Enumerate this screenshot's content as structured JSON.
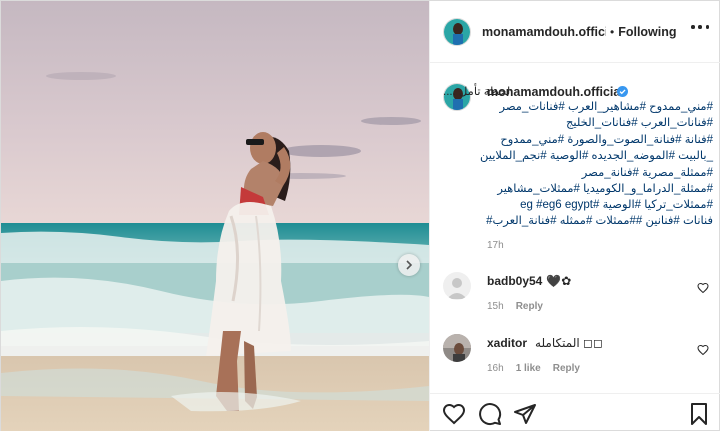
{
  "post": {
    "username": "monamamdouh.official",
    "header_username": "monamamdouh.officia",
    "dot": "•",
    "follow_label": "Following",
    "caption": {
      "lines": [
        "لحظة تأمل ....",
        "#مني_ممدوح #مشاهير_العرب #فنانات_مصر",
        "#فنانات_العرب #فنانات_الخليج",
        "#فنانة #فنانة_الصوت_والصورة #مني_ممدوح",
        "_بالبيت #الموضه_الجديده #الوصية #نجم_الملايين",
        "#ممثلة_مصرية #فنانة_مصر",
        "#ممثلة_الدراما_و_الكوميديا #ممثلات_مشاهير",
        "#ممثلات_تركيا #الوصية #eg #eg6 egypt",
        "فنانات #فنانين ##ممثلات #ممثله #فنانة_العرب#"
      ],
      "time": "17h"
    },
    "comments": [
      {
        "user": "badb0y54",
        "text": "🖤✿",
        "time": "15h",
        "reply": "Reply",
        "likes": ""
      },
      {
        "user": "xaditor",
        "text": "المتكامله ◻◻",
        "time": "16h",
        "reply": "Reply",
        "likes": "1 like"
      }
    ]
  },
  "icons": {
    "verified": "verified-badge-icon",
    "next": "chevron-right-icon",
    "like": "heart-icon",
    "comment": "comment-icon",
    "share": "paper-plane-icon",
    "save": "bookmark-icon",
    "more": "ellipsis-icon"
  },
  "colors": {
    "verified": "#3897f0",
    "hashtag": "#00376b",
    "muted": "#8e8e8e"
  }
}
